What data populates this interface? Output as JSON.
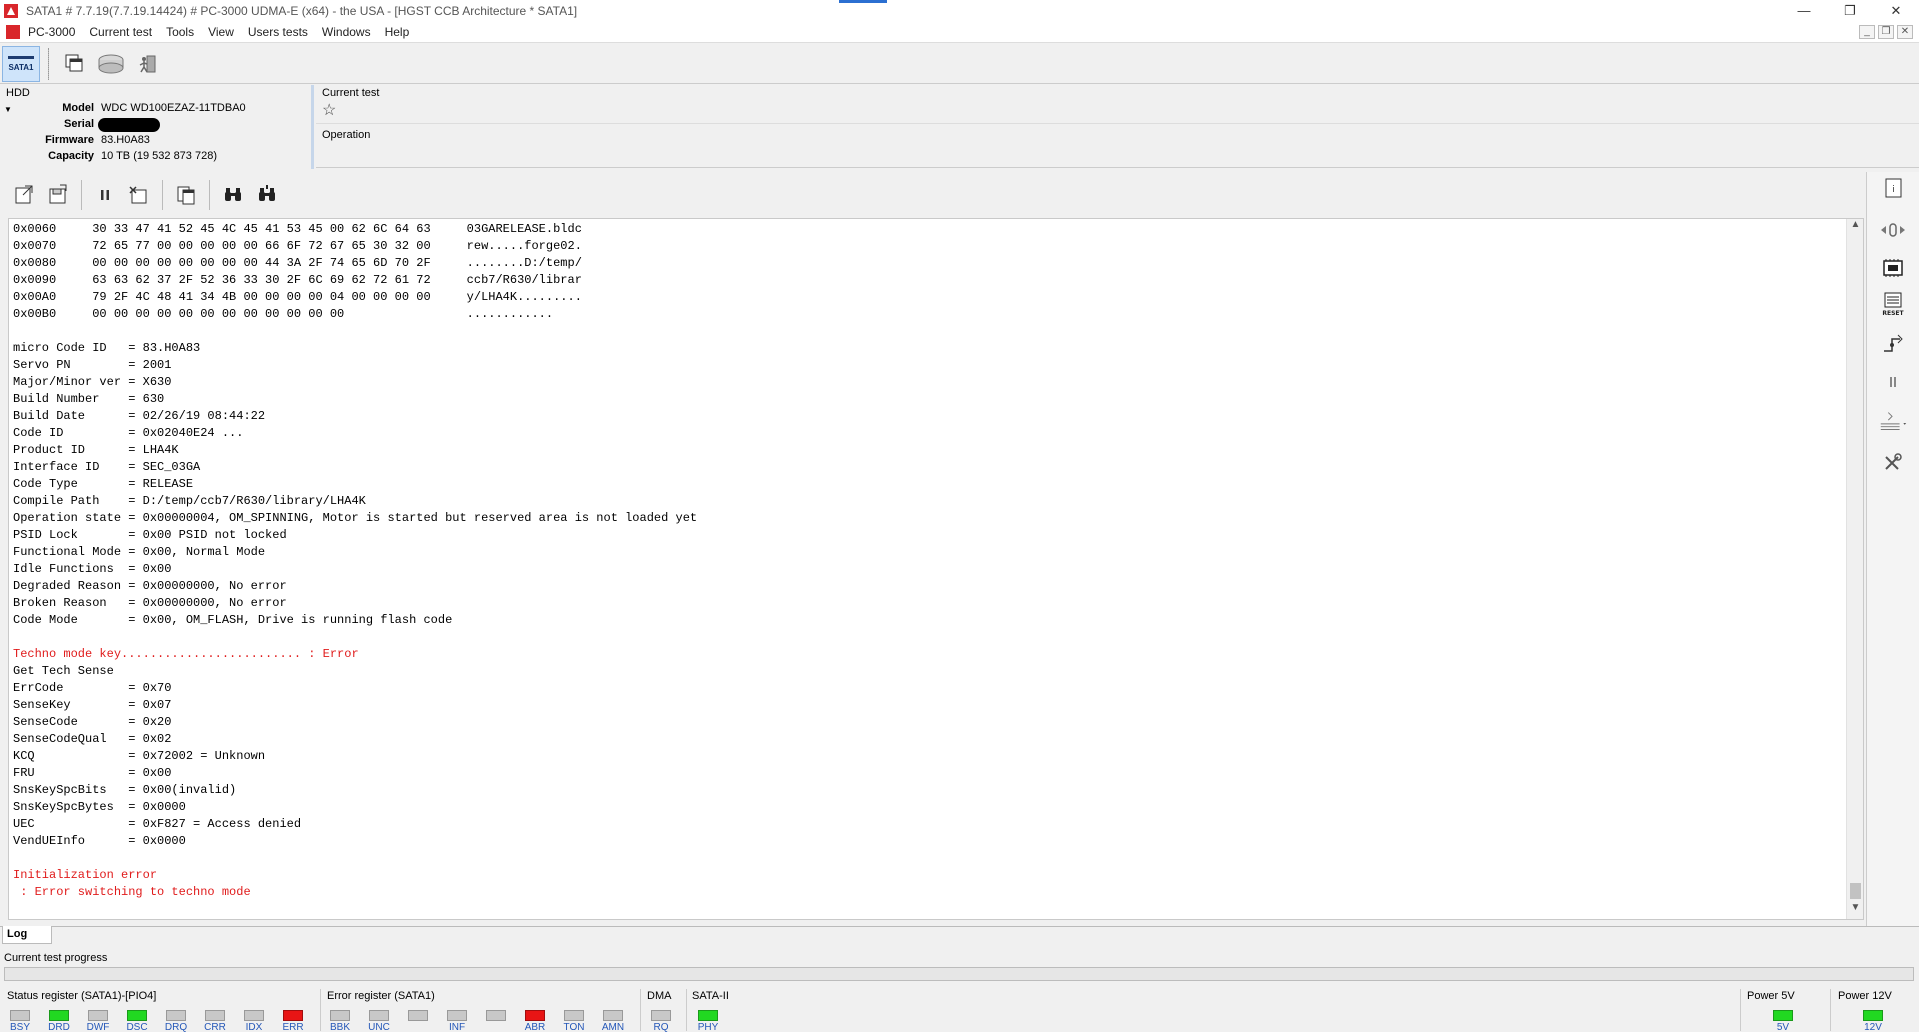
{
  "window": {
    "title": "SATA1 # 7.7.19(7.7.19.14424) # PC-3000 UDMA-E (x64) - the USA - [HGST CCB Architecture * SATA1]",
    "controls": [
      "—",
      "❐",
      "✕"
    ]
  },
  "menu": {
    "items": [
      "PC-3000",
      "Current test",
      "Tools",
      "View",
      "Users tests",
      "Windows",
      "Help"
    ]
  },
  "toolbar": {
    "sata_label": "SATA1"
  },
  "hdd": {
    "section_label": "HDD",
    "model_label": "Model",
    "model_value": "WDC WD100EZAZ-11TDBA0",
    "serial_label": "Serial",
    "firmware_label": "Firmware",
    "firmware_value": "83.H0A83",
    "capacity_label": "Capacity",
    "capacity_value": "10 TB (19 532 873 728)"
  },
  "current_test": {
    "label": "Current test",
    "operation_label": "Operation"
  },
  "log": {
    "lines": [
      {
        "text": "0x0060     30 33 47 41 52 45 4C 45 41 53 45 00 62 6C 64 63     03GARELEASE.bldc",
        "color": "black"
      },
      {
        "text": "0x0070     72 65 77 00 00 00 00 00 66 6F 72 67 65 30 32 00     rew.....forge02.",
        "color": "black"
      },
      {
        "text": "0x0080     00 00 00 00 00 00 00 00 44 3A 2F 74 65 6D 70 2F     ........D:/temp/",
        "color": "black"
      },
      {
        "text": "0x0090     63 63 62 37 2F 52 36 33 30 2F 6C 69 62 72 61 72     ccb7/R630/librar",
        "color": "black"
      },
      {
        "text": "0x00A0     79 2F 4C 48 41 34 4B 00 00 00 00 04 00 00 00 00     y/LHA4K.........",
        "color": "black"
      },
      {
        "text": "0x00B0     00 00 00 00 00 00 00 00 00 00 00 00                 ............",
        "color": "black"
      },
      {
        "text": "",
        "color": "black"
      },
      {
        "text": "micro Code ID   = 83.H0A83",
        "color": "black"
      },
      {
        "text": "Servo PN        = 2001",
        "color": "black"
      },
      {
        "text": "Major/Minor ver = X630",
        "color": "black"
      },
      {
        "text": "Build Number    = 630",
        "color": "black"
      },
      {
        "text": "Build Date      = 02/26/19 08:44:22",
        "color": "black"
      },
      {
        "text": "Code ID         = 0x02040E24 ...",
        "color": "black"
      },
      {
        "text": "Product ID      = LHA4K",
        "color": "black"
      },
      {
        "text": "Interface ID    = SEC_03GA",
        "color": "black"
      },
      {
        "text": "Code Type       = RELEASE",
        "color": "black"
      },
      {
        "text": "Compile Path    = D:/temp/ccb7/R630/library/LHA4K",
        "color": "black"
      },
      {
        "text": "Operation state = 0x00000004, OM_SPINNING, Motor is started but reserved area is not loaded yet",
        "color": "black"
      },
      {
        "text": "PSID Lock       = 0x00 PSID not locked",
        "color": "black"
      },
      {
        "text": "Functional Mode = 0x00, Normal Mode",
        "color": "black"
      },
      {
        "text": "Idle Functions  = 0x00",
        "color": "black"
      },
      {
        "text": "Degraded Reason = 0x00000000, No error",
        "color": "black"
      },
      {
        "text": "Broken Reason   = 0x00000000, No error",
        "color": "black"
      },
      {
        "text": "Code Mode       = 0x00, OM_FLASH, Drive is running flash code",
        "color": "black"
      },
      {
        "text": "",
        "color": "black"
      },
      {
        "text": "Techno mode key......................... : Error",
        "color": "red"
      },
      {
        "text": "Get Tech Sense",
        "color": "black"
      },
      {
        "text": "ErrCode         = 0x70",
        "color": "black"
      },
      {
        "text": "SenseKey        = 0x07",
        "color": "black"
      },
      {
        "text": "SenseCode       = 0x20",
        "color": "black"
      },
      {
        "text": "SenseCodeQual   = 0x02",
        "color": "black"
      },
      {
        "text": "KCQ             = 0x72002 = Unknown",
        "color": "black"
      },
      {
        "text": "FRU             = 0x00",
        "color": "black"
      },
      {
        "text": "SnsKeySpcBits   = 0x00(invalid)",
        "color": "black"
      },
      {
        "text": "SnsKeySpcBytes  = 0x0000",
        "color": "black"
      },
      {
        "text": "UEC             = 0xF827 = Access denied",
        "color": "black"
      },
      {
        "text": "VendUEInfo      = 0x0000",
        "color": "black"
      },
      {
        "text": "",
        "color": "black"
      },
      {
        "text": "Initialization error",
        "color": "red"
      },
      {
        "text": " : Error switching to techno mode",
        "color": "red"
      }
    ],
    "tab_label": "Log"
  },
  "progress": {
    "label": "Current test progress",
    "value": 0
  },
  "status": {
    "status_register_label": "Status register (SATA1)-[PIO4]",
    "status_leds": [
      {
        "name": "BSY",
        "state": "off"
      },
      {
        "name": "DRD",
        "state": "green"
      },
      {
        "name": "DWF",
        "state": "off"
      },
      {
        "name": "DSC",
        "state": "green"
      },
      {
        "name": "DRQ",
        "state": "off"
      },
      {
        "name": "CRR",
        "state": "off"
      },
      {
        "name": "IDX",
        "state": "off"
      },
      {
        "name": "ERR",
        "state": "red"
      }
    ],
    "error_register_label": "Error register (SATA1)",
    "error_leds": [
      {
        "name": "BBK",
        "state": "off"
      },
      {
        "name": "UNC",
        "state": "off"
      },
      {
        "name": "",
        "state": "off"
      },
      {
        "name": "INF",
        "state": "off"
      },
      {
        "name": "",
        "state": "off"
      },
      {
        "name": "ABR",
        "state": "red"
      },
      {
        "name": "TON",
        "state": "off"
      },
      {
        "name": "AMN",
        "state": "off"
      }
    ],
    "dma_label": "DMA",
    "dma_led": {
      "name": "RQ",
      "state": "off"
    },
    "sata_label": "SATA-II",
    "sata_led": {
      "name": "PHY",
      "state": "green"
    },
    "power5_label": "Power 5V",
    "power5_led": {
      "name": "5V",
      "state": "green"
    },
    "power12_label": "Power 12V",
    "power12_led": {
      "name": "12V",
      "state": "green"
    }
  },
  "colors": {
    "error_text": "#e01b1b",
    "led_green": "#21d821",
    "led_red": "#e81515",
    "led_name": "#2457b8"
  }
}
